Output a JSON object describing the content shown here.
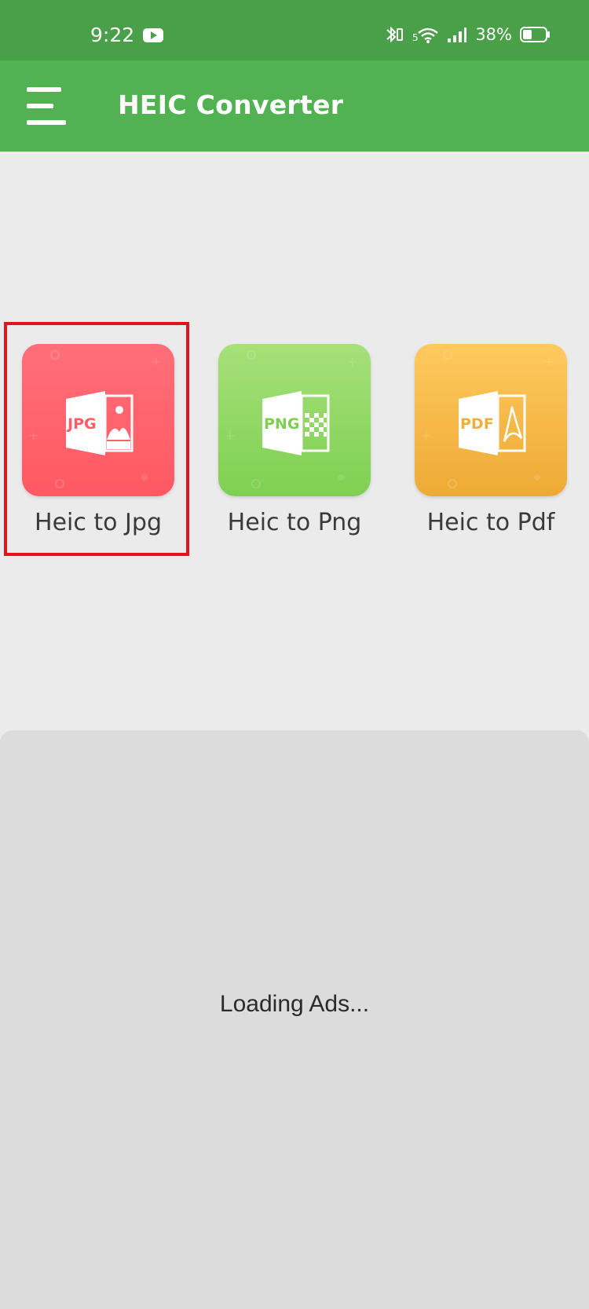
{
  "status_bar": {
    "time": "9:22",
    "battery_text": "38%",
    "icons": [
      "youtube-icon",
      "bluetooth-icon",
      "wifi-icon",
      "signal-icon",
      "battery-icon"
    ]
  },
  "app_bar": {
    "title": "HEIC Converter",
    "menu_icon": "hamburger-menu-icon",
    "background_color": "#51b251"
  },
  "tiles": [
    {
      "label": "Heic to Jpg",
      "badge": "JPG",
      "color": "#ff5e67",
      "selected": true
    },
    {
      "label": "Heic to Png",
      "badge": "PNG",
      "color": "#84d258",
      "selected": false
    },
    {
      "label": "Heic to Pdf",
      "badge": "PDF",
      "color": "#f2b442",
      "selected": false
    }
  ],
  "ad": {
    "text": "Loading Ads..."
  }
}
